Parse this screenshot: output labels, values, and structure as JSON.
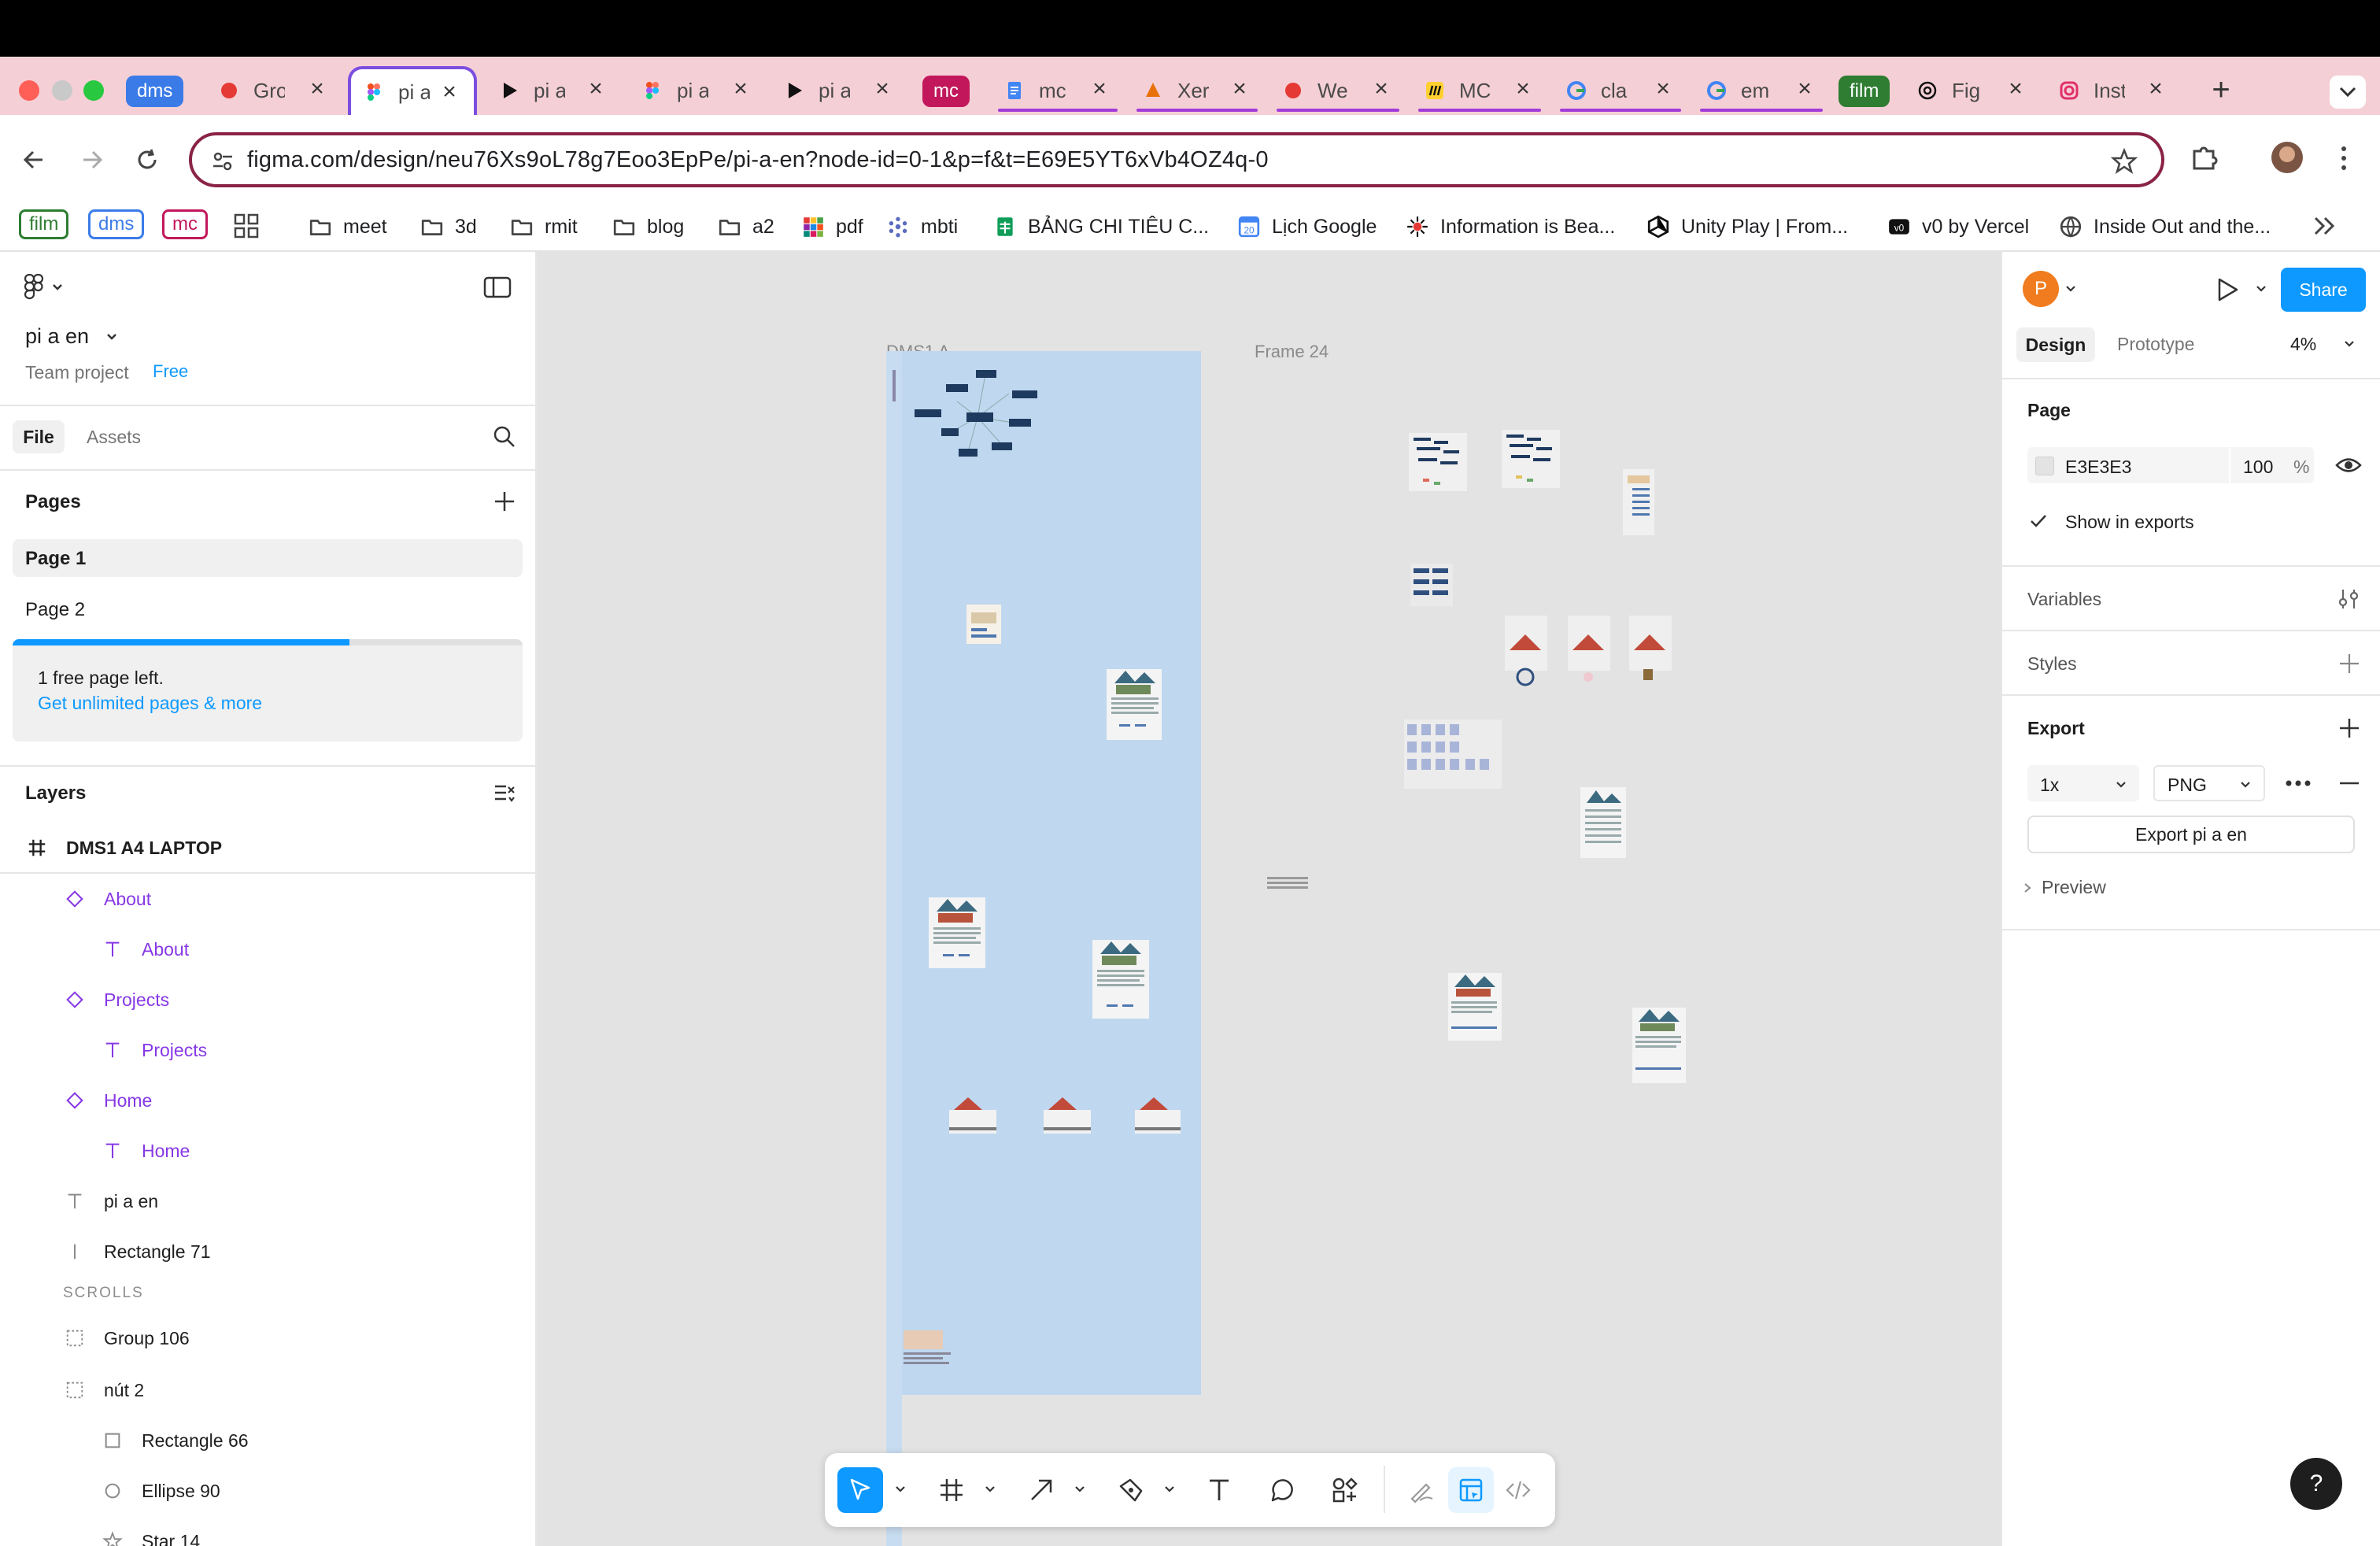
{
  "browser": {
    "tabs": [
      {
        "group": "dms",
        "group_color": "#3b7be8"
      },
      {
        "title": "Gro",
        "icon": "red-app-icon"
      },
      {
        "title": "pi a",
        "icon": "figma-icon",
        "active": true
      },
      {
        "title": "pi a",
        "icon": "play-icon"
      },
      {
        "title": "pi a",
        "icon": "figma-icon"
      },
      {
        "title": "pi a",
        "icon": "play-icon"
      },
      {
        "group": "mc",
        "group_color": "#c2185b"
      },
      {
        "title": "mc",
        "icon": "google-docs-icon"
      },
      {
        "title": "Xer",
        "icon": "slides-icon"
      },
      {
        "title": "We",
        "icon": "red-app-icon"
      },
      {
        "title": "MC",
        "icon": "miro-icon"
      },
      {
        "title": "cla",
        "icon": "google-icon"
      },
      {
        "title": "em",
        "icon": "google-icon"
      },
      {
        "group": "film",
        "group_color": "#2e7d32"
      },
      {
        "title": "Fig",
        "icon": "openai-icon"
      },
      {
        "title": "Inst",
        "icon": "instagram-icon"
      }
    ],
    "url": "figma.com/design/neu76Xs9oL78g7Eoo3EpPe/pi-a-en?node-id=0-1&p=f&t=E69E5YT6xVb4OZ4q-0",
    "bookmark_groups": [
      {
        "label": "film",
        "color": "#2e7d32"
      },
      {
        "label": "dms",
        "color": "#3b7be8"
      },
      {
        "label": "mc",
        "color": "#c2185b"
      }
    ],
    "bookmarks": [
      {
        "label": "meet",
        "icon": "folder-icon"
      },
      {
        "label": "3d",
        "icon": "folder-icon"
      },
      {
        "label": "rmit",
        "icon": "folder-icon"
      },
      {
        "label": "blog",
        "icon": "folder-icon"
      },
      {
        "label": "a2",
        "icon": "folder-icon"
      },
      {
        "label": "pdf",
        "icon": "color-grid-icon"
      },
      {
        "label": "mbti",
        "icon": "dots-icon"
      },
      {
        "label": "BẢNG CHI TIÊU C...",
        "icon": "sheets-icon"
      },
      {
        "label": "Lịch Google",
        "icon": "calendar-icon"
      },
      {
        "label": "Information is Bea...",
        "icon": "star-burst-icon"
      },
      {
        "label": "Unity Play | From...",
        "icon": "unity-icon"
      },
      {
        "label": "v0 by Vercel",
        "icon": "v0-icon"
      },
      {
        "label": "Inside Out and the...",
        "icon": "globe-icon"
      }
    ]
  },
  "figma": {
    "file_name": "pi a en",
    "project": "Team project",
    "plan_badge": "Free",
    "tabs": {
      "file": "File",
      "assets": "Assets"
    },
    "pages_title": "Pages",
    "pages": [
      "Page 1",
      "Page 2"
    ],
    "free_notice": "1 free page left.",
    "upgrade_link": "Get unlimited pages & more",
    "layers_title": "Layers",
    "layers": [
      {
        "label": "DMS1 A4 LAPTOP",
        "icon": "frame-hash-icon",
        "depth": 0,
        "kind": "frame"
      },
      {
        "label": "About",
        "icon": "component-instance-icon",
        "depth": 1,
        "kind": "comp"
      },
      {
        "label": "About",
        "icon": "text-t-icon",
        "depth": 2,
        "kind": "comp"
      },
      {
        "label": "Projects",
        "icon": "component-instance-icon",
        "depth": 1,
        "kind": "comp"
      },
      {
        "label": "Projects",
        "icon": "text-t-icon",
        "depth": 2,
        "kind": "comp"
      },
      {
        "label": "Home",
        "icon": "component-instance-icon",
        "depth": 1,
        "kind": "comp"
      },
      {
        "label": "Home",
        "icon": "text-t-icon",
        "depth": 2,
        "kind": "comp"
      },
      {
        "label": "pi a en",
        "icon": "text-t-icon",
        "depth": 1,
        "kind": "plain"
      },
      {
        "label": "Rectangle 71",
        "icon": "line-icon",
        "depth": 1,
        "kind": "plain"
      },
      {
        "label": "SCROLLS",
        "icon": "",
        "depth": 1,
        "kind": "section"
      },
      {
        "label": "Group 106",
        "icon": "group-dashed-icon",
        "depth": 1,
        "kind": "plain"
      },
      {
        "label": "nút 2",
        "icon": "group-dashed-icon",
        "depth": 1,
        "kind": "plain"
      },
      {
        "label": "Rectangle 66",
        "icon": "rectangle-icon",
        "depth": 2,
        "kind": "plain"
      },
      {
        "label": "Ellipse 90",
        "icon": "ellipse-icon",
        "depth": 2,
        "kind": "plain"
      },
      {
        "label": "Star 14",
        "icon": "star-icon",
        "depth": 2,
        "kind": "plain"
      }
    ],
    "canvas": {
      "frame1_label": "DMS1 A...",
      "frame2_label": "Frame 24",
      "background": "#E3E3E3",
      "frame_fill": "#BFD7EF"
    },
    "right": {
      "avatar_letter": "P",
      "share_label": "Share",
      "tab_design": "Design",
      "tab_prototype": "Prototype",
      "zoom": "4%",
      "page_section": "Page",
      "page_color": "E3E3E3",
      "page_opacity": "100",
      "percent_sign": "%",
      "show_in_exports": "Show in exports",
      "variables": "Variables",
      "styles": "Styles",
      "export": "Export",
      "export_scale": "1x",
      "export_format": "PNG",
      "export_button": "Export pi a en",
      "preview": "Preview"
    },
    "help": "?"
  },
  "colors": {
    "accent": "#0d99ff",
    "component": "#8638e5"
  }
}
